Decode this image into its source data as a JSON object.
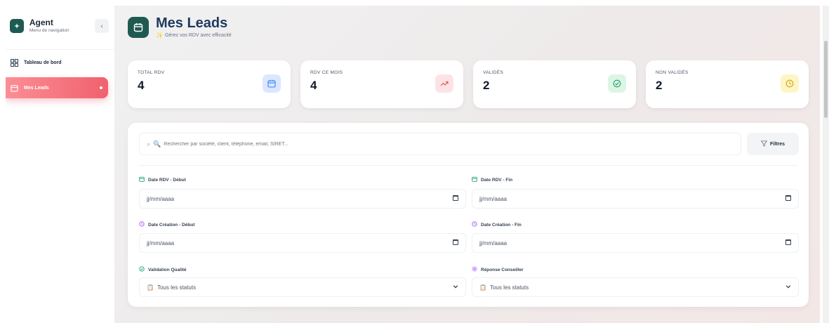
{
  "sidebar": {
    "brand_title": "Agent",
    "brand_subtitle": "Menu de navigation",
    "collapse_glyph": "‹",
    "items": [
      {
        "label": "Tableau de bord",
        "icon": "grid-icon",
        "active": false
      },
      {
        "label": "Mes Leads",
        "icon": "calendar-icon",
        "active": true
      }
    ]
  },
  "header": {
    "title": "Mes Leads",
    "subtitle": "Gérez vos RDV avec efficacité",
    "icon": "calendar-icon"
  },
  "stats": [
    {
      "label": "TOTAL RDV",
      "value": "4",
      "icon": "calendar-icon",
      "bg": "#dbe7ff",
      "fg": "#3b82f6"
    },
    {
      "label": "RDV CE MOIS",
      "value": "4",
      "icon": "trending-up-icon",
      "bg": "#fde4e4",
      "fg": "#e25563"
    },
    {
      "label": "VALIDÉS",
      "value": "2",
      "icon": "check-circle-icon",
      "bg": "#dcf5e5",
      "fg": "#22a06b"
    },
    {
      "label": "NON VALIDÉS",
      "value": "2",
      "icon": "clock-icon",
      "bg": "#fdf6c4",
      "fg": "#d4a017"
    }
  ],
  "filters": {
    "search_placeholder": "Rechercher par société, client, téléphone, email, SIRET...",
    "filter_button_label": "Filtres",
    "date_rdv_start_label": "Date RDV - Début",
    "date_rdv_end_label": "Date RDV - Fin",
    "date_creation_start_label": "Date Création - Début",
    "date_creation_end_label": "Date Création - Fin",
    "validation_label": "Validation Qualité",
    "conseiller_label": "Réponse Conseiller",
    "date_placeholder": "jj/mm/aaaa",
    "status_value": "Tous les statuts"
  },
  "colors": {
    "accent": "#f0616e",
    "brand": "#1f5a52",
    "title": "#1e3a5f"
  }
}
